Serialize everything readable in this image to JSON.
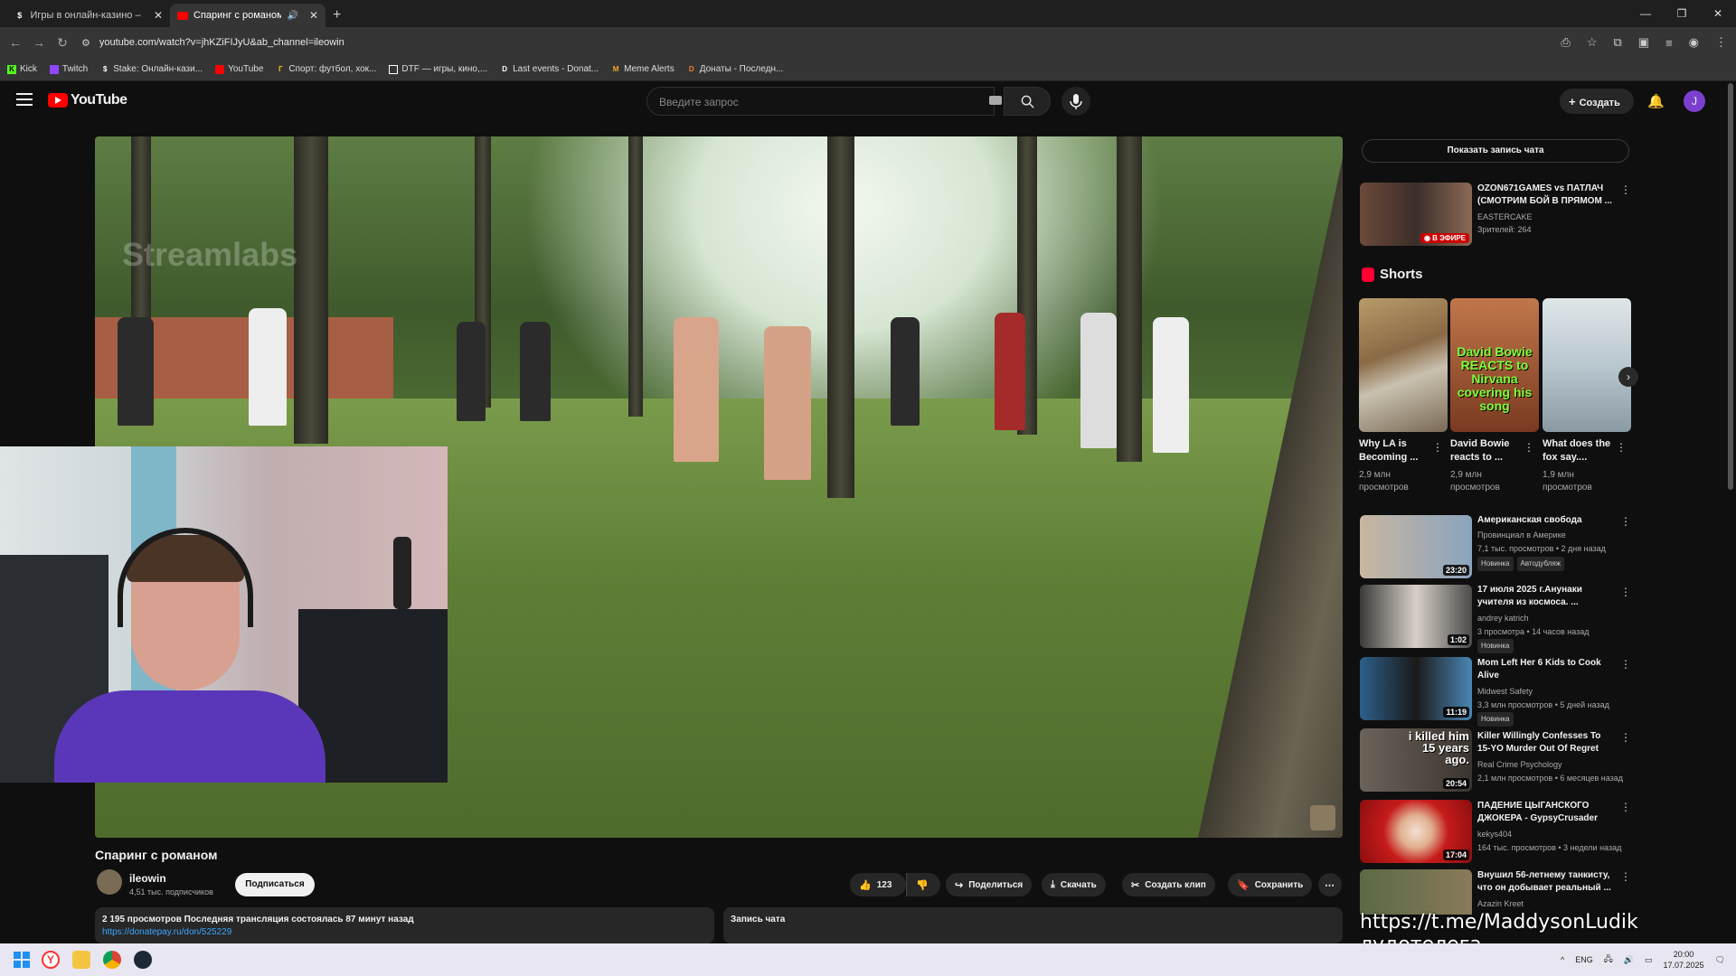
{
  "browser": {
    "tabs": [
      {
        "label": "Игры в онлайн-казино – слот",
        "favicon": "S",
        "active": false
      },
      {
        "label": "Спаринг с романом - YouT",
        "favicon": "yt",
        "active": true
      }
    ],
    "new_tab": "+",
    "url": "youtube.com/watch?v=jhKZiFIJyU&ab_channel=ileowin",
    "bookmarks": [
      {
        "label": "Kick",
        "color": "#53fc18"
      },
      {
        "label": "Twitch",
        "color": "#9146ff"
      },
      {
        "label": "Stake: Онлайн-кази...",
        "color": "#ffffff"
      },
      {
        "label": "YouTube",
        "color": "#ff0000"
      },
      {
        "label": "Спорт: футбол, хок...",
        "color": "#f5c518"
      },
      {
        "label": "DTF — игры, кино,...",
        "color": "#ffffff"
      },
      {
        "label": "Last events - Donat...",
        "color": "#ffffff"
      },
      {
        "label": "Meme Alerts",
        "color": "#f5a623"
      },
      {
        "label": "Донаты - Последн...",
        "color": "#f58220"
      }
    ]
  },
  "youtube": {
    "logo_text": "YouTube",
    "search_placeholder": "Введите запрос",
    "create_label": "Создать",
    "avatar_letter": "J"
  },
  "video": {
    "watermark": "Streamlabs",
    "title": "Спаринг с романом",
    "channel": "ileowin",
    "subscribers": "4,51 тыс. подписчиков",
    "subscribe_label": "Подписаться",
    "likes": "123",
    "share_label": "Поделиться",
    "download_label": "Скачать",
    "clip_label": "Создать клип",
    "save_label": "Сохранить",
    "stats": "2 195 просмотров  Последняя трансляция состоялась 87 минут назад",
    "link": "https://donatepay.ru/don/525229",
    "chat_replay_label": "Запись чата"
  },
  "sidebar": {
    "show_chat_label": "Показать запись чата",
    "live_item": {
      "title": "OZON671GAMES vs ПАТЛАЧ (СМОТРИМ БОЙ В ПРЯМОМ ...",
      "channel": "EASTERCAKE",
      "meta": "Зрителей: 264",
      "live_badge": "В ЭФИРЕ"
    },
    "shorts_heading": "Shorts",
    "shorts": [
      {
        "title": "Why LA is Becoming ...",
        "views": "2,9 млн просмотров",
        "thumb_text": ""
      },
      {
        "title": "David Bowie reacts to ...",
        "views": "2,9 млн просмотров",
        "thumb_text": "David Bowie REACTS to Nirvana covering his song"
      },
      {
        "title": "What does the fox say....",
        "views": "1,9 млн просмотров",
        "thumb_text": ""
      }
    ],
    "videos": [
      {
        "title": "Американская свобода",
        "channel": "Провинциал в Америке",
        "meta": "7,1 тыс. просмотров • 2 дня назад",
        "badges": [
          "Новинка",
          "Автодубляж"
        ],
        "duration": "23:20"
      },
      {
        "title": "17 июля 2025 г.Анунаки учителя из космоса. ...",
        "channel": "andrey katrich",
        "meta": "3 просмотра • 14 часов назад",
        "badges": [
          "Новинка"
        ],
        "duration": "1:02"
      },
      {
        "title": "Mom Left Her 6 Kids to Cook Alive",
        "channel": "Midwest Safety",
        "meta": "3,3 млн просмотров • 5 дней назад",
        "badges": [
          "Новинка"
        ],
        "duration": "11:19"
      },
      {
        "title": "Killer Willingly Confesses To 15-YO Murder Out Of Regret",
        "channel": "Real Crime Psychology",
        "meta": "2,1 млн просмотров • 6 месяцев назад",
        "badges": [],
        "duration": "20:54",
        "thumb_text": "i killed him 15 years ago."
      },
      {
        "title": "ПАДЕНИЕ ЦЫГАНСКОГО ДЖОКЕРА - GypsyCrusader",
        "channel": "kekys404",
        "meta": "164 тыс. просмотров • 3 недели назад",
        "badges": [],
        "duration": "17:04"
      },
      {
        "title": "Внушил 56-летнему танкисту, что он добывает реальный ...",
        "channel": "Azazin Kreet",
        "meta": "",
        "badges": [],
        "duration": ""
      }
    ]
  },
  "overlay_text": "https://t.me/MaddysonLudik лудотелега",
  "taskbar": {
    "lang": "ENG",
    "time": "20:00",
    "date": "17.07.2025"
  },
  "colors": {
    "bg": "#0f0f0f",
    "accent_red": "#ff0000",
    "link_blue": "#3ea6ff"
  }
}
